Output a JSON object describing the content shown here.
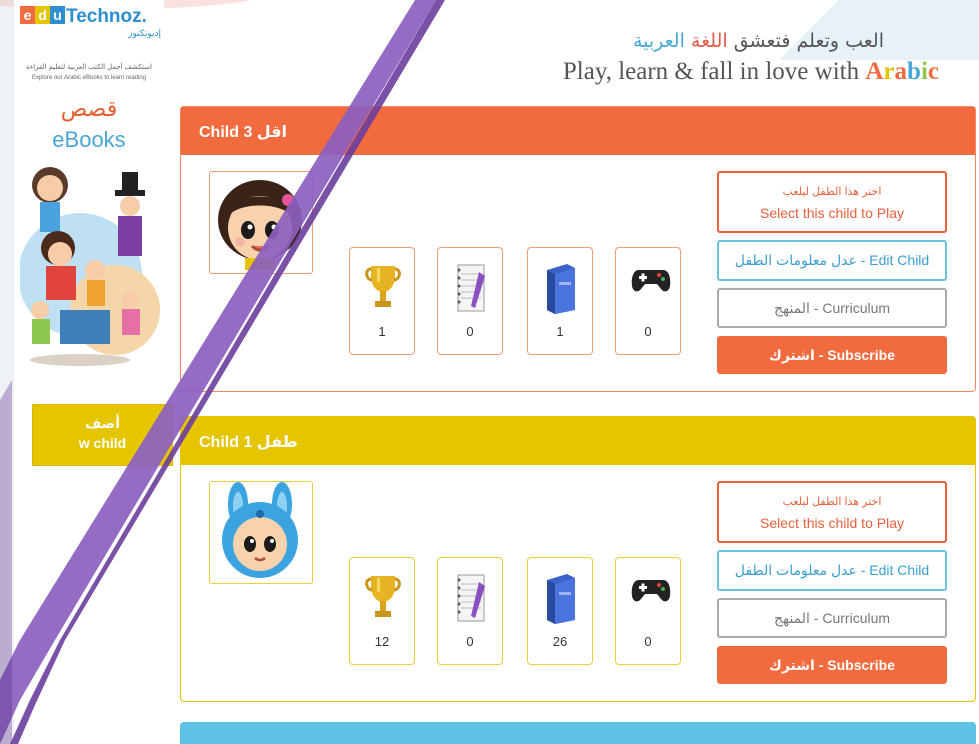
{
  "brand": {
    "logo_letters": [
      "e",
      "d",
      "u"
    ],
    "logo_word": "Technoz.",
    "logo_arabic": "إديوتكنوز",
    "tagline_arabic": "استكشف أجمل الكتب العربية لتعليم القراءة",
    "tagline_english": "Explore our Arabic eBooks to learn reading",
    "qisas": "قصص",
    "ebooks": "eBooks"
  },
  "header": {
    "arabic_prefix": "العب وتعلم فتعشق",
    "arabic_word1": "اللغة",
    "arabic_word2": "العربية",
    "english_main": "Play, learn & fall in love with",
    "english_highlight": "Arabic"
  },
  "sidebar": {
    "add_child_line1": "أضف",
    "add_child_line2": "w child"
  },
  "children": [
    {
      "title": "Child 3 اقل",
      "theme": "orange",
      "avatar": "girl-avatar",
      "stats": [
        {
          "icon": "trophy-icon",
          "value": "1"
        },
        {
          "icon": "notebook-icon",
          "value": "0"
        },
        {
          "icon": "book-icon",
          "value": "1"
        },
        {
          "icon": "gamepad-icon",
          "value": "0"
        }
      ],
      "select_ar": "اختر هذا الطفل ليلعب",
      "select_en": "Select this child to Play",
      "edit": "عدل معلومات الطفل - Edit Child",
      "curriculum": "المنهج - Curriculum",
      "subscribe": "اشترك - Subscribe"
    },
    {
      "title": "Child 1 طفل",
      "theme": "yellow",
      "avatar": "bunny-avatar",
      "stats": [
        {
          "icon": "trophy-icon",
          "value": "12"
        },
        {
          "icon": "notebook-icon",
          "value": "0"
        },
        {
          "icon": "book-icon",
          "value": "26"
        },
        {
          "icon": "gamepad-icon",
          "value": "0"
        }
      ],
      "select_ar": "اختر هذا الطفل ليلعب",
      "select_en": "Select this child to Play",
      "edit": "عدل معلومات الطفل - Edit Child",
      "curriculum": "المنهج - Curriculum",
      "subscribe": "اشترك - Subscribe"
    }
  ],
  "colors": {
    "orange": "#f26b3f",
    "yellow": "#e5c400",
    "blue": "#5fc3e6",
    "swoosh": "#8b5fbf"
  }
}
